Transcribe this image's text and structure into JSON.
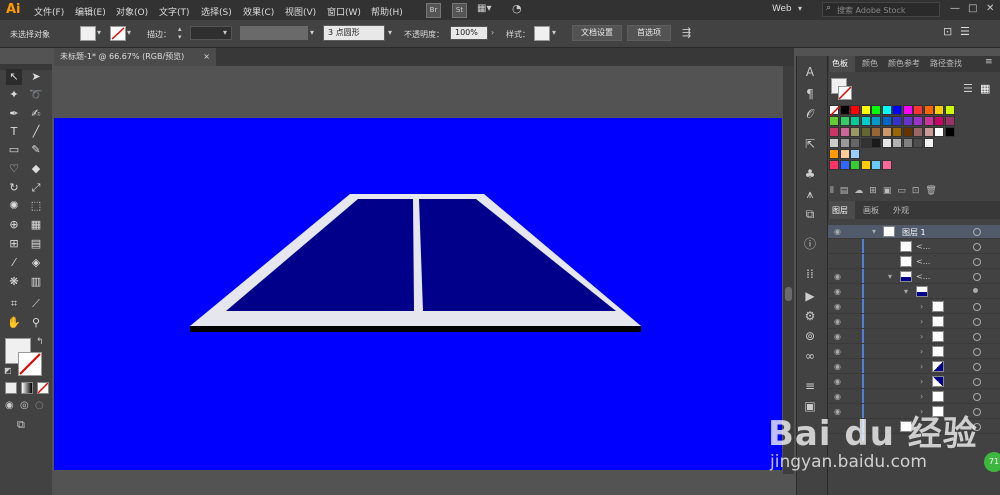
{
  "app": {
    "logo": "Ai"
  },
  "menu": [
    "文件(F)",
    "编辑(E)",
    "对象(O)",
    "文字(T)",
    "选择(S)",
    "效果(C)",
    "视图(V)",
    "窗口(W)",
    "帮助(H)"
  ],
  "menubar_icons": {
    "bridge": "Br",
    "stock": "St"
  },
  "workspace": "Web",
  "search": {
    "placeholder": "搜索 Adobe Stock"
  },
  "control_bar": {
    "no_selection": "未选择对象",
    "stroke_label": "描边：",
    "brush": "3 点圆形",
    "opacity_label": "不透明度：",
    "opacity_value": "100%",
    "style_label": "样式：",
    "doc_setup": "文档设置",
    "preferences": "首选项"
  },
  "document_tab": {
    "title": "未标题-1* @ 66.67% (RGB/预览)",
    "close": "×"
  },
  "swatches_panel": {
    "tabs": [
      "色板",
      "颜色",
      "颜色参考",
      "路径查找"
    ],
    "row1": [
      "#ffffff",
      "#000000",
      "#ff0000",
      "#ffff00",
      "#00ff00",
      "#00ffff",
      "#0000ff",
      "#ff00ff",
      "#ff3333",
      "#ff6600",
      "#ffcc00",
      "#ccff00"
    ],
    "row2": [
      "#66cc33",
      "#33cc66",
      "#00cc99",
      "#00cccc",
      "#0099cc",
      "#0066cc",
      "#3333cc",
      "#6633cc",
      "#9933cc",
      "#cc3399",
      "#cc0066",
      "#993366"
    ],
    "row3": [
      "#cc3366",
      "#cc6699",
      "#999966",
      "#666633",
      "#996633",
      "#cc9966",
      "#996600",
      "#663300",
      "#996666",
      "#cc9999",
      "#ffffff",
      "#000000"
    ],
    "row4": [
      "#cccccc",
      "#999999",
      "#666666",
      "#333333",
      "#1a1a1a",
      "#e6e6e6",
      "#b3b3b3",
      "#808080",
      "#4d4d4d",
      "#f2f2f2"
    ],
    "row5": [
      "#ff9900",
      "#ffcc99",
      "#99ccff"
    ],
    "row6": [
      "#ff3366",
      "#3366ff",
      "#33cc33",
      "#ffcc00",
      "#66ccff",
      "#ff6699"
    ]
  },
  "layers_panel": {
    "tabs": [
      "图层",
      "画板",
      "外观"
    ],
    "layer_name": "图层 1",
    "sublayer_label": "<..."
  },
  "watermark": {
    "line1": "Bai du 经验",
    "line2": "jingyan.baidu.com",
    "badge": "71"
  }
}
